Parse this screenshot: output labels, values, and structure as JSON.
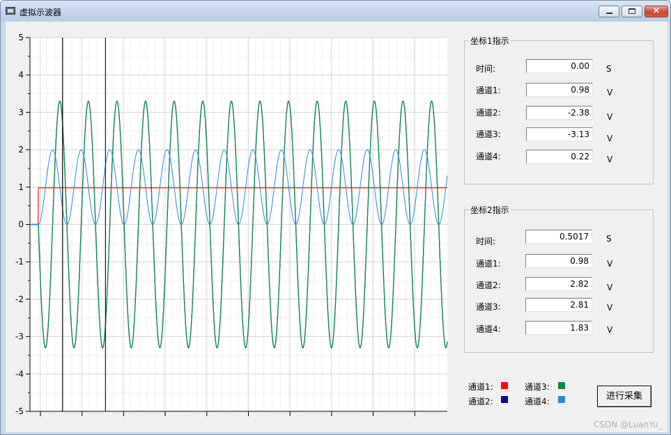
{
  "window": {
    "title": "虚拟示波器",
    "close_glyph": "×"
  },
  "colors": {
    "channel1": "#ee1111",
    "channel2": "#0a0a8a",
    "channel3": "#0b8a4a",
    "channel4": "#2a8ad0",
    "cursor1": "#000000",
    "cursor2": "#0a0a8a"
  },
  "cursor1_panel": {
    "title": "坐标1指示",
    "time_label": "时间:",
    "time_value": "0.00",
    "time_unit": "S",
    "ch1_label": "通道1:",
    "ch1_value": "0.98",
    "ch1_unit": "V",
    "ch2_label": "通道2:",
    "ch2_value": "-2.38",
    "ch2_unit": "V",
    "ch3_label": "通道3:",
    "ch3_value": "-3.13",
    "ch3_unit": "V",
    "ch4_label": "通道4:",
    "ch4_value": "0.22",
    "ch4_unit": "V"
  },
  "cursor2_panel": {
    "title": "坐标2指示",
    "time_label": "时间:",
    "time_value": "0.5017",
    "time_unit": "S",
    "ch1_label": "通道1:",
    "ch1_value": "0.98",
    "ch1_unit": "V",
    "ch2_label": "通道2:",
    "ch2_value": "2.82",
    "ch2_unit": "V",
    "ch3_label": "通道3:",
    "ch3_value": "2.81",
    "ch3_unit": "V",
    "ch4_label": "通道4:",
    "ch4_value": "1.83",
    "ch4_unit": "V"
  },
  "legend": {
    "ch1": "通道1:",
    "ch2": "通道2:",
    "ch3": "通道3:",
    "ch4": "通道4:"
  },
  "collect_button": "进行采集",
  "watermark": "CSDN @LuanYu_",
  "chart_data": {
    "type": "line",
    "ylim": [
      -5,
      5
    ],
    "y_ticks": [
      "5",
      "4",
      "3",
      "2",
      "1",
      "0",
      "-1",
      "-2",
      "-3",
      "-4",
      "-5"
    ],
    "x_tick_count": 10,
    "grid": true,
    "cursor1_x_fraction": 0.078,
    "cursor2_x_fraction": 0.181,
    "series": [
      {
        "key": "channel1",
        "kind": "dc",
        "level": 0.98,
        "start_fraction": 0.02
      },
      {
        "key": "channel2",
        "kind": "sine",
        "amplitude": 3.3,
        "offset": 0,
        "cycles": 14.3,
        "start_fraction": 0.02
      },
      {
        "key": "channel3",
        "kind": "sine",
        "amplitude": 3.3,
        "offset": 0,
        "cycles": 14.3,
        "start_fraction": 0.02
      },
      {
        "key": "channel4",
        "kind": "sine",
        "amplitude": 1.0,
        "offset": 1.0,
        "cycles": 14.3,
        "start_fraction": 0.02
      }
    ]
  }
}
